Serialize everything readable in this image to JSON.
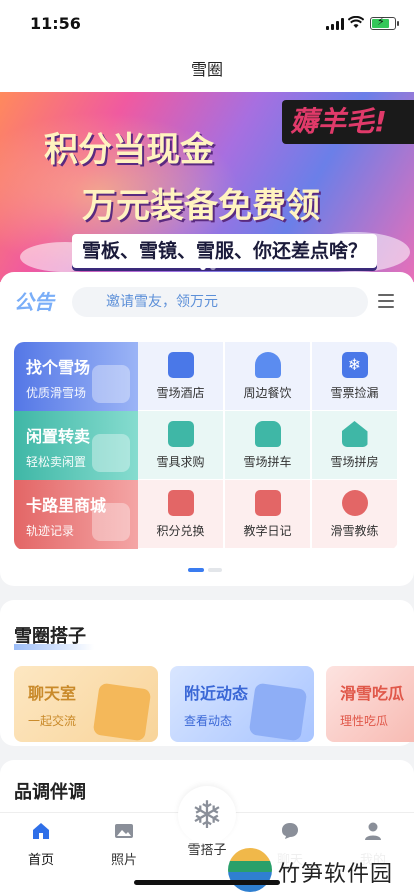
{
  "status_bar": {
    "time": "11:56"
  },
  "nav": {
    "title": "雪圈"
  },
  "banner": {
    "tag": "薅羊毛!",
    "line1": "积分当现金",
    "line2": "万元装备免费领",
    "slogan": "雪板、雪镜、雪服、你还差点啥？"
  },
  "notice": {
    "logo": "公告",
    "search_text": "邀请雪友，领万元"
  },
  "features": {
    "big": [
      {
        "title": "找个雪场",
        "sub": "优质滑雪场"
      },
      {
        "title": "闲置转卖",
        "sub": "轻松卖闲置"
      },
      {
        "title": "卡路里商城",
        "sub": "轨迹记录"
      }
    ],
    "grid": [
      {
        "label": "雪场酒店",
        "icon": "hotel-icon",
        "color": "#4a78e8"
      },
      {
        "label": "周边餐饮",
        "icon": "dining-bell-icon",
        "color": "#5b8cf0"
      },
      {
        "label": "雪票捡漏",
        "icon": "snowflake-ticket-icon",
        "color": "#4a78e8"
      },
      {
        "label": "雪具求购",
        "icon": "ski-gear-icon",
        "color": "#3fb7a6"
      },
      {
        "label": "雪场拼车",
        "icon": "car-icon",
        "color": "#3fb7a6"
      },
      {
        "label": "雪场拼房",
        "icon": "house-icon",
        "color": "#3fb7a6"
      },
      {
        "label": "积分兑换",
        "icon": "points-book-icon",
        "color": "#e36666"
      },
      {
        "label": "教学日记",
        "icon": "calendar-icon",
        "color": "#e36666"
      },
      {
        "label": "滑雪教练",
        "icon": "skier-icon",
        "color": "#e36666"
      }
    ]
  },
  "section_partners": {
    "heading": "雪圈搭子",
    "tiles": [
      {
        "title": "聊天室",
        "sub": "一起交流"
      },
      {
        "title": "附近动态",
        "sub": "查看动态"
      },
      {
        "title": "滑雪吃瓜",
        "sub": "理性吃瓜"
      }
    ]
  },
  "section_next": {
    "heading": "品调伴调"
  },
  "tabbar": {
    "items": [
      {
        "label": "首页",
        "icon": "home-icon",
        "active": true
      },
      {
        "label": "照片",
        "icon": "photo-icon"
      },
      {
        "label": "雪搭子",
        "icon": "snowflake-icon"
      },
      {
        "label": "聊天",
        "icon": "chat-icon"
      },
      {
        "label": "我的",
        "icon": "profile-icon"
      }
    ]
  },
  "watermark": {
    "text": "竹笋软件园"
  },
  "colors": {
    "accent": "#3a7cf0",
    "active_tab": "#2f6fe8"
  }
}
